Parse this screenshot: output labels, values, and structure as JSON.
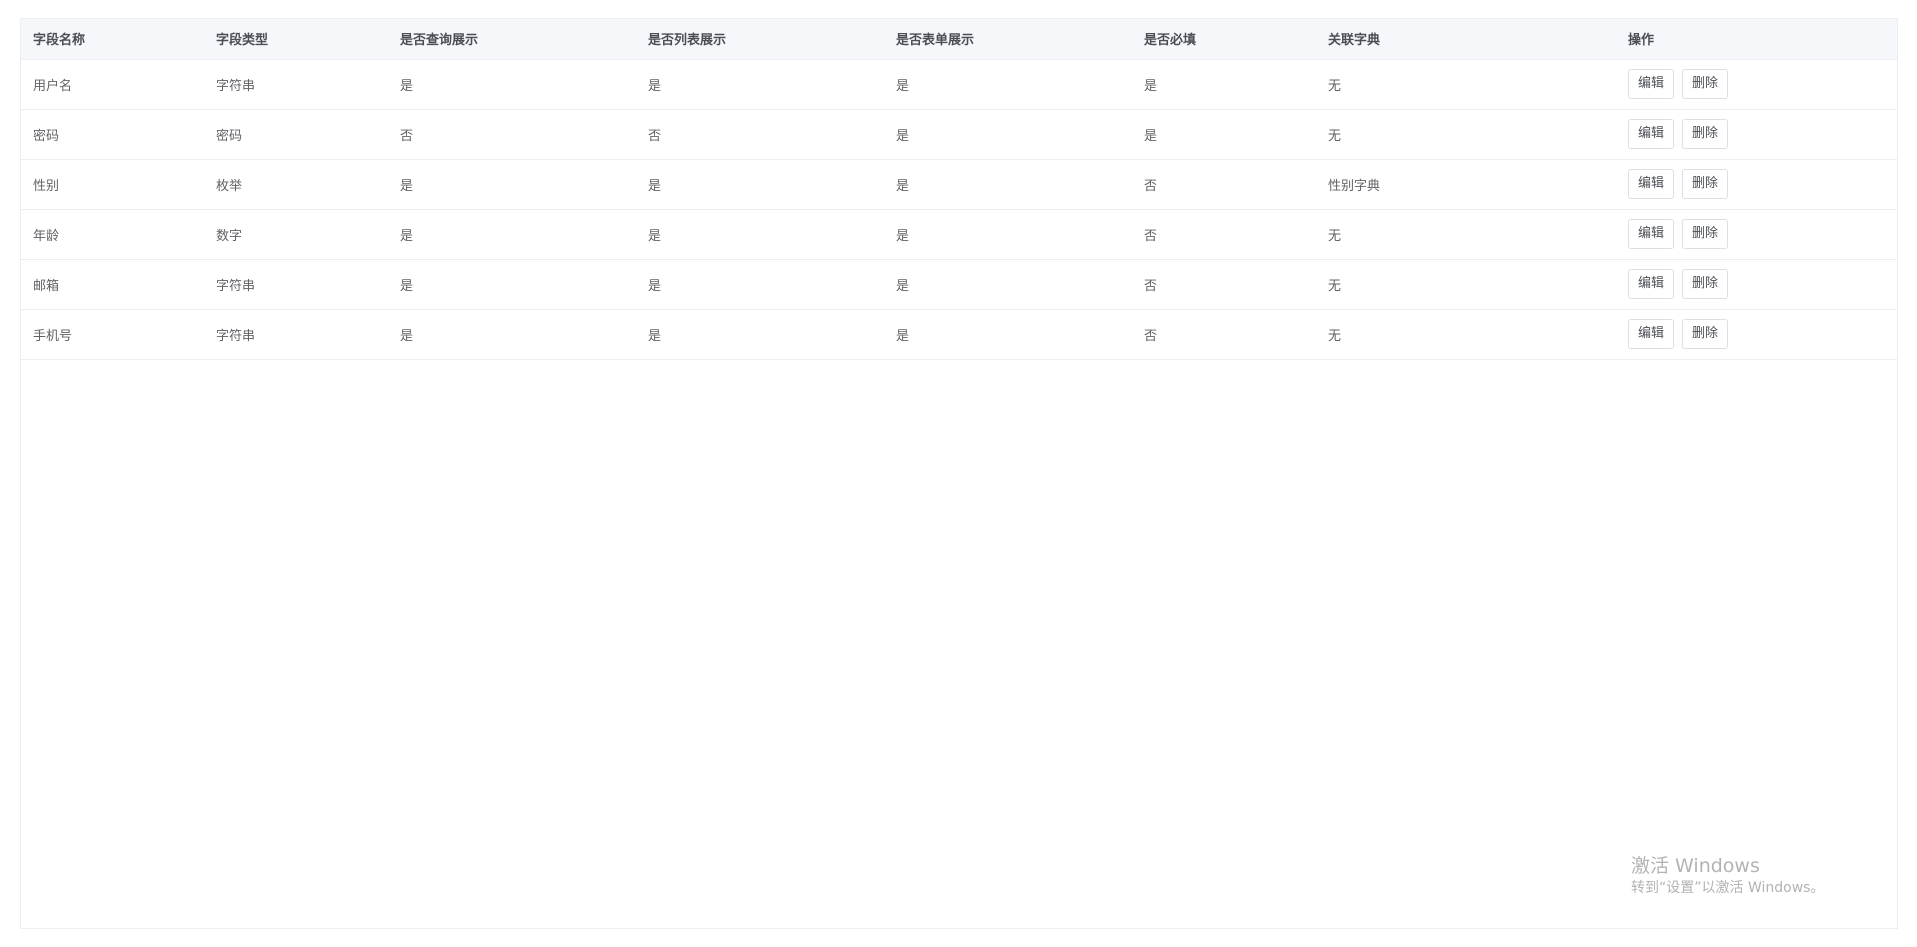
{
  "table": {
    "columns": [
      "字段名称",
      "字段类型",
      "是否查询展示",
      "是否列表展示",
      "是否表单展示",
      "是否必填",
      "关联字典",
      "操作"
    ],
    "rows": [
      {
        "name": "用户名",
        "type": "字符串",
        "query": "是",
        "list": "是",
        "form": "是",
        "required": "是",
        "dict": "无"
      },
      {
        "name": "密码",
        "type": "密码",
        "query": "否",
        "list": "否",
        "form": "是",
        "required": "是",
        "dict": "无"
      },
      {
        "name": "性别",
        "type": "枚举",
        "query": "是",
        "list": "是",
        "form": "是",
        "required": "否",
        "dict": "性别字典"
      },
      {
        "name": "年龄",
        "type": "数字",
        "query": "是",
        "list": "是",
        "form": "是",
        "required": "否",
        "dict": "无"
      },
      {
        "name": "邮箱",
        "type": "字符串",
        "query": "是",
        "list": "是",
        "form": "是",
        "required": "否",
        "dict": "无"
      },
      {
        "name": "手机号",
        "type": "字符串",
        "query": "是",
        "list": "是",
        "form": "是",
        "required": "否",
        "dict": "无"
      }
    ],
    "actions": {
      "edit_label": "编辑",
      "delete_label": "删除"
    }
  },
  "watermark": {
    "title": "激活 Windows",
    "subtitle": "转到“设置”以激活 Windows。"
  },
  "colors": {
    "header_bg": "#f5f7fa",
    "border": "#ebeef5",
    "text": "#606266",
    "button_border": "#dcdfe6"
  }
}
